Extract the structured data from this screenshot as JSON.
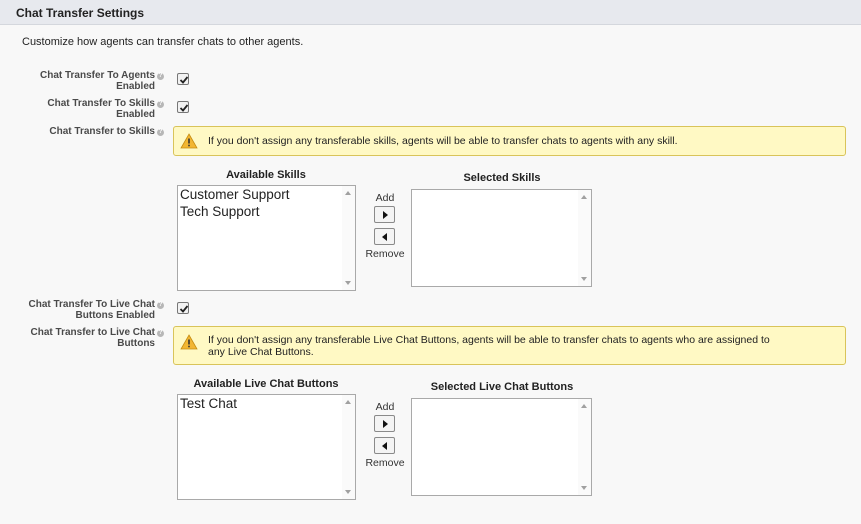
{
  "header": {
    "title": "Chat Transfer Settings"
  },
  "intro": "Customize how agents can transfer chats to other agents.",
  "fields": {
    "agents_enabled": {
      "label_line1": "Chat Transfer To Agents",
      "label_line2": "Enabled",
      "checked": true
    },
    "skills_enabled": {
      "label_line1": "Chat Transfer To Skills",
      "label_line2": "Enabled",
      "checked": true
    },
    "skills": {
      "label": "Chat Transfer to Skills"
    },
    "buttons_enabled": {
      "label_line1": "Chat Transfer To Live Chat",
      "label_line2": "Buttons Enabled",
      "checked": true
    },
    "buttons": {
      "label_line1": "Chat Transfer to Live Chat",
      "label_line2": "Buttons"
    }
  },
  "warnings": {
    "skills": "If you don't assign any transferable skills, agents will be able to transfer chats to agents with any skill.",
    "buttons_line1": "If you don't assign any transferable Live Chat Buttons, agents will be able to transfer chats to agents who are assigned to",
    "buttons_line2": "any Live Chat Buttons."
  },
  "skills_picker": {
    "available_title": "Available Skills",
    "selected_title": "Selected Skills",
    "available": [
      "Customer Support",
      "Tech Support"
    ],
    "selected": [],
    "add_label": "Add",
    "remove_label": "Remove"
  },
  "buttons_picker": {
    "available_title": "Available Live Chat Buttons",
    "selected_title": "Selected Live Chat Buttons",
    "available": [
      "Test Chat"
    ],
    "selected": [],
    "add_label": "Add",
    "remove_label": "Remove"
  }
}
